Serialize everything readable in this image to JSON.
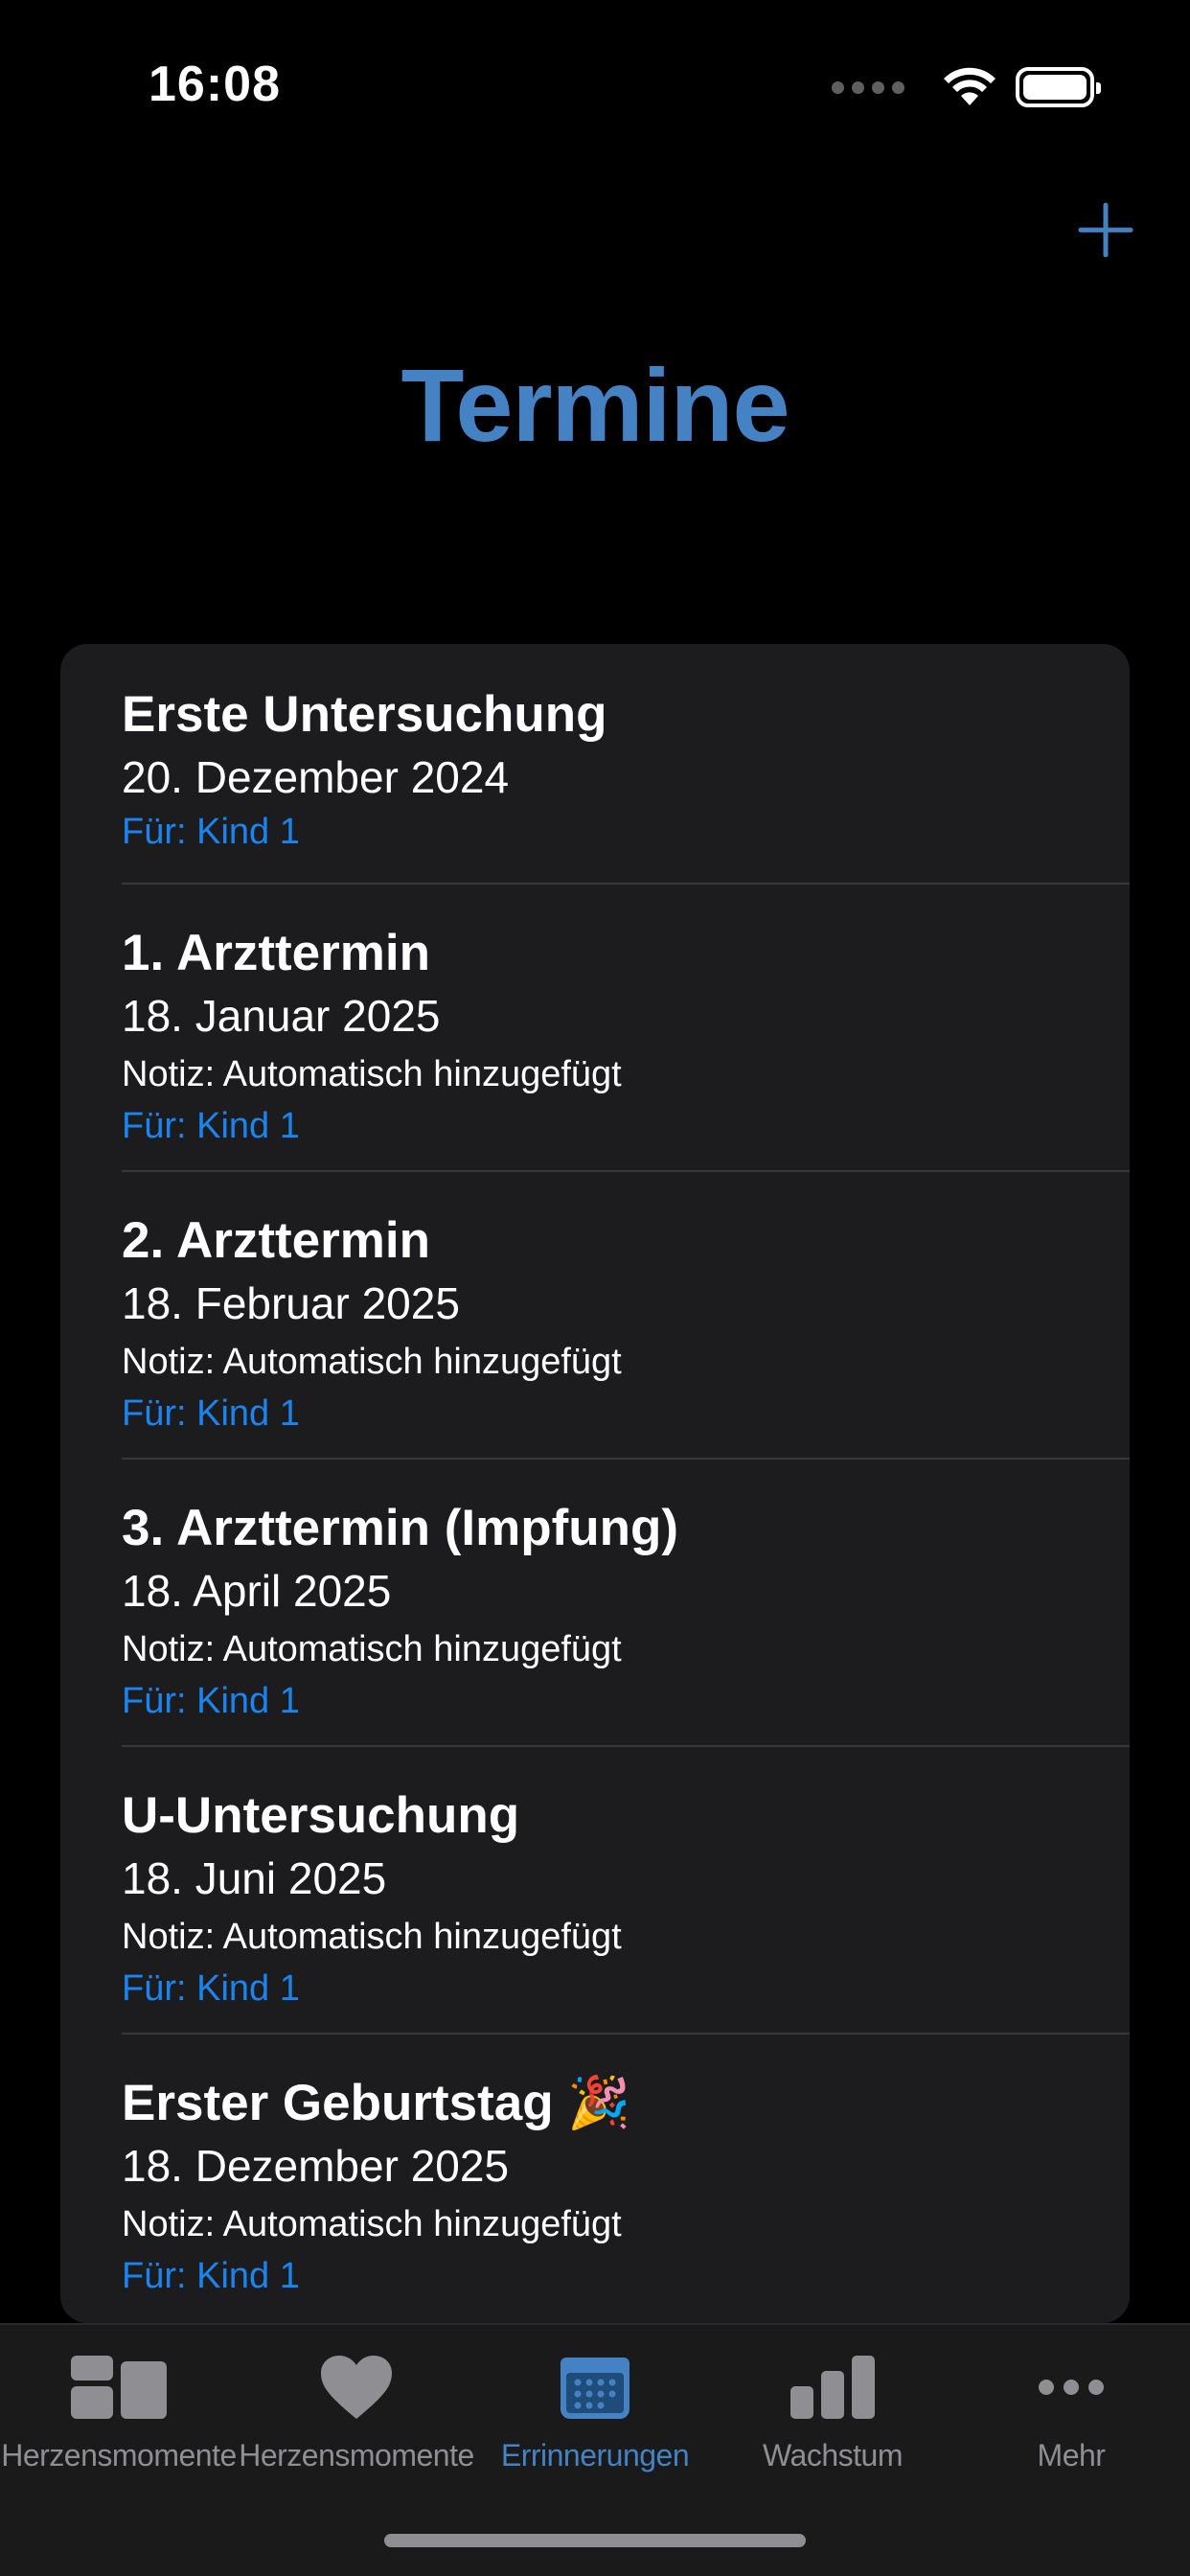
{
  "status_bar": {
    "time": "16:08"
  },
  "header": {
    "title": "Termine",
    "add_icon": "plus-icon"
  },
  "appointments": [
    {
      "title": "Erste Untersuchung",
      "date": "20. Dezember 2024",
      "note": "",
      "for": "Für: Kind 1"
    },
    {
      "title": "1. Arzttermin",
      "date": "18. Januar 2025",
      "note": "Notiz: Automatisch hinzugefügt",
      "for": "Für: Kind 1"
    },
    {
      "title": "2. Arzttermin",
      "date": "18. Februar 2025",
      "note": "Notiz: Automatisch hinzugefügt",
      "for": "Für: Kind 1"
    },
    {
      "title": "3. Arzttermin (Impfung)",
      "date": "18. April 2025",
      "note": "Notiz: Automatisch hinzugefügt",
      "for": "Für: Kind 1"
    },
    {
      "title": "U-Untersuchung",
      "date": "18. Juni 2025",
      "note": "Notiz: Automatisch hinzugefügt",
      "for": "Für: Kind 1"
    },
    {
      "title": "Erster Geburtstag 🎉",
      "date": "18. Dezember 2025",
      "note": "Notiz: Automatisch hinzugefügt",
      "for": "Für: Kind 1"
    }
  ],
  "tabs": [
    {
      "label": "Herzensmomente",
      "icon": "dashboard-icon",
      "active": false
    },
    {
      "label": "Herzensmomente",
      "icon": "heart-icon",
      "active": false
    },
    {
      "label": "Errinnerungen",
      "icon": "calendar-icon",
      "active": true
    },
    {
      "label": "Wachstum",
      "icon": "bar-chart-icon",
      "active": false
    },
    {
      "label": "Mehr",
      "icon": "more-icon",
      "active": false
    }
  ],
  "colors": {
    "accent": "#4482c4",
    "link": "#1a84f0",
    "card": "#1c1c1e",
    "inactive": "#8e8e93"
  }
}
